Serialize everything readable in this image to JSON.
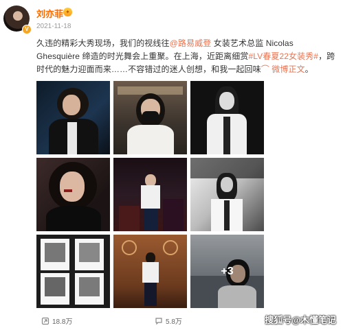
{
  "post": {
    "username": "刘亦菲",
    "timestamp": "2021-11-18",
    "text_line1_a": "久违的精彩大秀现场，我们的视线往",
    "mention": "@路易威登",
    "text_line1_b": " 女装艺术总监 Nicolas Ghesquière 缔",
    "text_line2": "造的时光舞会上重聚。在上海，近距离细赏",
    "hashtag": "#LV春夏22女装秀#",
    "text_line2_b": "，跨时代的魅力迎面而",
    "text_line3": "来……不容错过的迷人创想，和我一起回味",
    "link_label": "微博正文",
    "text_line3_end": "。"
  },
  "grid": {
    "more_label": "+3"
  },
  "footer": {
    "shares": "18.8万",
    "comments": "5.8万"
  },
  "watermark": "搜狐号@木懂笔记",
  "colors": {
    "username": "#f86a00",
    "link": "#eb7350"
  }
}
